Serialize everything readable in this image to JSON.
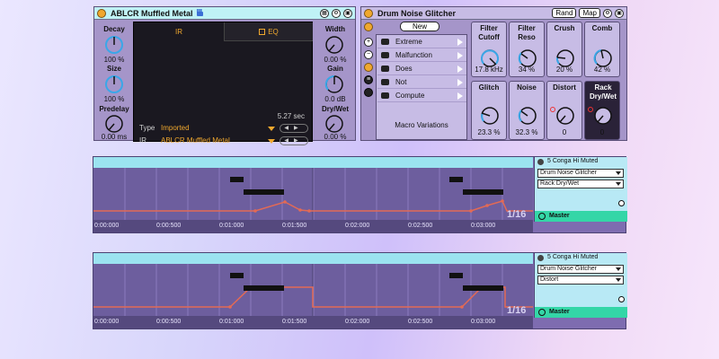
{
  "reverb": {
    "title": "ABLCR Muffled Metal",
    "knobs": [
      {
        "label": "Decay",
        "value": "100 %"
      },
      {
        "label": "Size",
        "value": "100 %"
      },
      {
        "label": "Predelay",
        "value": "0.00 ms"
      },
      {
        "label": "Width",
        "value": "0.00 %"
      },
      {
        "label": "Gain",
        "value": "0.0 dB"
      },
      {
        "label": "Dry/Wet",
        "value": "0.00 %"
      }
    ],
    "tabs": [
      "IR",
      "EQ"
    ],
    "duration": "5.27 sec",
    "type_label": "Type",
    "type_value": "Imported",
    "ir_label": "IR",
    "ir_value": "ABLCR Muffled Metal"
  },
  "glitch": {
    "title": "Drum Noise Glitcher",
    "rand_label": "Rand",
    "map_label": "Map",
    "new_label": "New",
    "presets": [
      "Extreme",
      "Malfunction",
      "Does",
      "Not",
      "Compute"
    ],
    "macro_variations_label": "Macro Variations",
    "macros": [
      {
        "label": "Filter Cutoff",
        "value": "17.8 kHz"
      },
      {
        "label": "Filter Reso",
        "value": "34 %"
      },
      {
        "label": "Crush",
        "value": "20 %"
      },
      {
        "label": "Comb",
        "value": "42 %"
      },
      {
        "label": "Glitch",
        "value": "23.3 %"
      },
      {
        "label": "Noise",
        "value": "32.3 %"
      },
      {
        "label": "Distort",
        "value": "0"
      },
      {
        "label": "Rack Dry/Wet",
        "value": "0"
      }
    ]
  },
  "clips": [
    {
      "track": "5 Conga Hi Muted",
      "device": "Drum Noise Glitcher",
      "parameter": "Rack Dry/Wet",
      "quantize": "1/16",
      "master": "Master",
      "ticks": [
        "0:00:000",
        "0:00:500",
        "0:01:000",
        "0:01:500",
        "0:02:000",
        "0:02:500",
        "0:03:000"
      ]
    },
    {
      "track": "5 Conga Hi Muted",
      "device": "Drum Noise Glitcher",
      "parameter": "Distort",
      "quantize": "1/16",
      "master": "Master",
      "ticks": [
        "0:00:000",
        "0:00:500",
        "0:01:000",
        "0:01:500",
        "0:02:000",
        "0:02:500",
        "0:03:000"
      ]
    }
  ],
  "colors": {
    "accent_orange": "#f0a82e",
    "knob_blue": "#3aa7e8",
    "header_cyan": "#bff2f5",
    "master_green": "#34d6a7",
    "automation": "#e36a55"
  }
}
